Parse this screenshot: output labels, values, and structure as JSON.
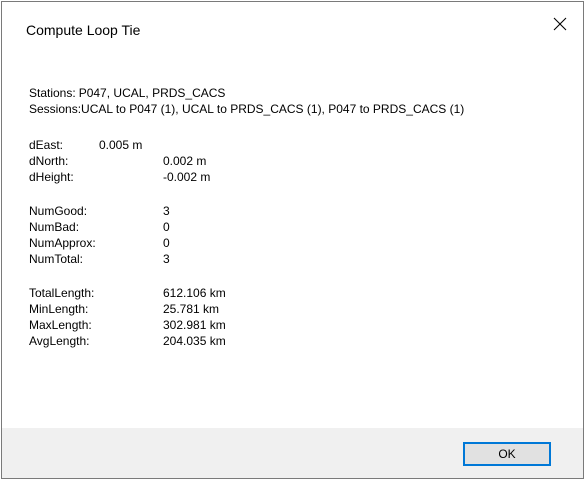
{
  "window": {
    "title": "Compute Loop Tie",
    "close_icon": "close-icon"
  },
  "summary": {
    "stations_label": "Stations:",
    "stations_value": "P047, UCAL, PRDS_CACS",
    "sessions_label": "Sessions:",
    "sessions_value": "UCAL to P047 (1), UCAL to PRDS_CACS (1), P047 to PRDS_CACS (1)"
  },
  "deltas": [
    {
      "label": "dEast:",
      "value": "0.005 m"
    },
    {
      "label": "dNorth:",
      "value": "0.002 m"
    },
    {
      "label": "dHeight:",
      "value": "-0.002 m"
    }
  ],
  "counts": [
    {
      "label": "NumGood:",
      "value": "3"
    },
    {
      "label": "NumBad:",
      "value": "0"
    },
    {
      "label": "NumApprox:",
      "value": "0"
    },
    {
      "label": "NumTotal:",
      "value": "3"
    }
  ],
  "lengths": [
    {
      "label": "TotalLength:",
      "value": "612.106 km"
    },
    {
      "label": "MinLength:",
      "value": "25.781 km"
    },
    {
      "label": "MaxLength:",
      "value": "302.981 km"
    },
    {
      "label": "AvgLength:",
      "value": "204.035 km"
    }
  ],
  "buttons": {
    "ok_label": "OK"
  },
  "colors": {
    "accent": "#0078d7",
    "footer_bg": "#f0f0f0",
    "button_bg": "#e1e1e1"
  }
}
